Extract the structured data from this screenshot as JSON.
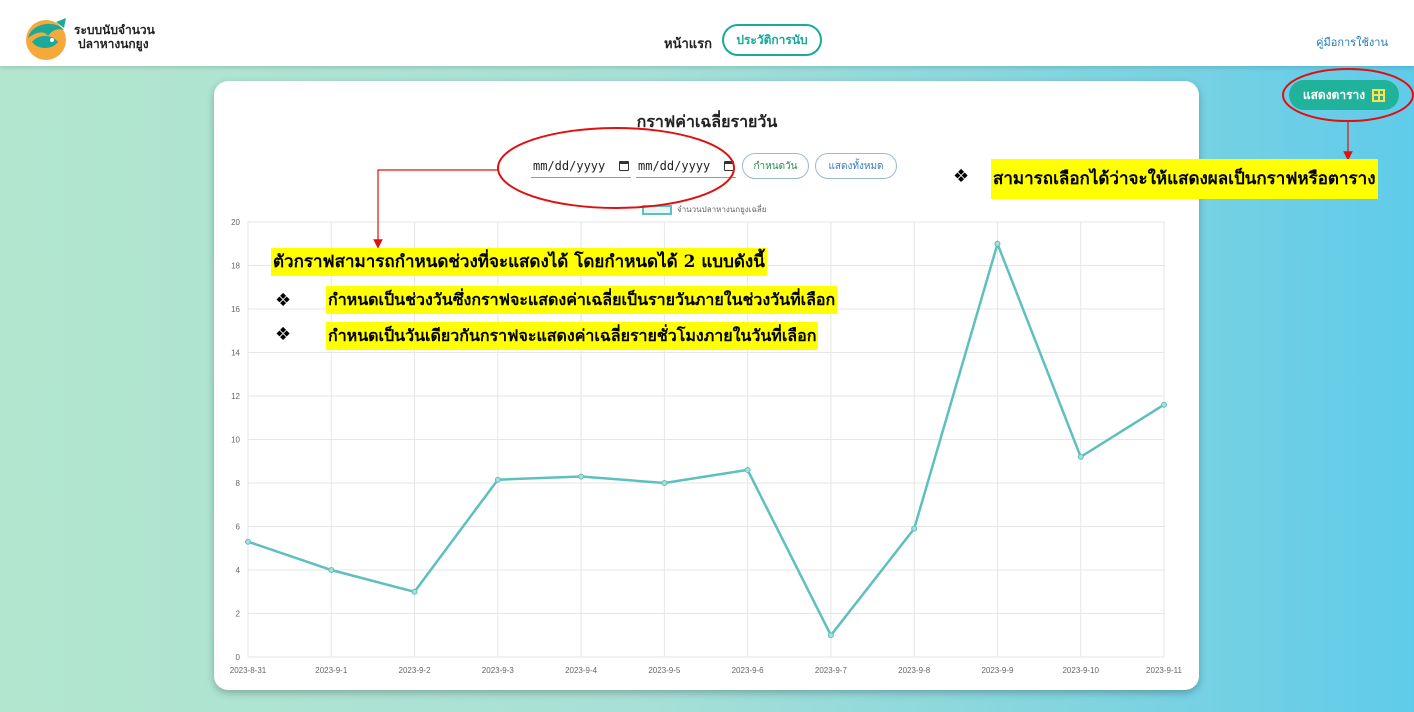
{
  "brand": {
    "line1": "ระบบนับจำนวน",
    "line2": "ปลาหางนกยูง"
  },
  "nav": {
    "home": "หน้าแรก",
    "history": "ประวัติการนับ",
    "manual": "คู่มือการใช้งาน"
  },
  "card": {
    "title": "กราฟค่าเฉลี่ยรายวัน",
    "date_from_placeholder": "mm/dd/yyyy",
    "date_to_placeholder": "mm/dd/yyyy",
    "filter_button": "กำหนดวัน",
    "show_all_button": "แสดงทั้งหมด",
    "legend": "จำนวนปลาหางนกยูงเฉลี่ย"
  },
  "table_button": "แสดงตาราง",
  "annotations": {
    "right_note": "สามารถเลือกได้ว่าจะให้แสดงผลเป็นกราฟหรือตาราง",
    "left_title": "ตัวกราฟสามารถกำหนดช่วงที่จะแสดงได้ โดยกำหนดได้ 2 แบบดังนี้",
    "left_item1": "กำหนดเป็นช่วงวันซึ่งกราฟจะแสดงค่าเฉลี่ยเป็นรายวันภายในช่วงวันที่เลือก",
    "left_item2": "กำหนดเป็นวันเดียวกันกราฟจะแสดงค่าเฉลี่ยรายชั่วโมงภายในวันที่เลือก",
    "bullet": "❖"
  },
  "colors": {
    "accent": "#20b29b",
    "line": "#5ec0be",
    "annotation": "#ffff00",
    "marker": "#e01010"
  },
  "chart_data": {
    "type": "line",
    "categories": [
      "2023-8-31",
      "2023-9-1",
      "2023-9-2",
      "2023-9-3",
      "2023-9-4",
      "2023-9-5",
      "2023-9-6",
      "2023-9-7",
      "2023-9-8",
      "2023-9-9",
      "2023-9-10",
      "2023-9-11"
    ],
    "series": [
      {
        "name": "จำนวนปลาหางนกยูงเฉลี่ย",
        "values": [
          5.3,
          4.0,
          3.0,
          8.15,
          8.3,
          8.0,
          8.6,
          1.0,
          5.9,
          19.0,
          9.2,
          11.6
        ]
      }
    ],
    "yticks": [
      "0",
      "2",
      "4",
      "6",
      "8",
      "10",
      "12",
      "14",
      "16",
      "18",
      "20"
    ],
    "ylim": [
      0,
      20
    ],
    "grid": true,
    "legend": "top-center"
  }
}
